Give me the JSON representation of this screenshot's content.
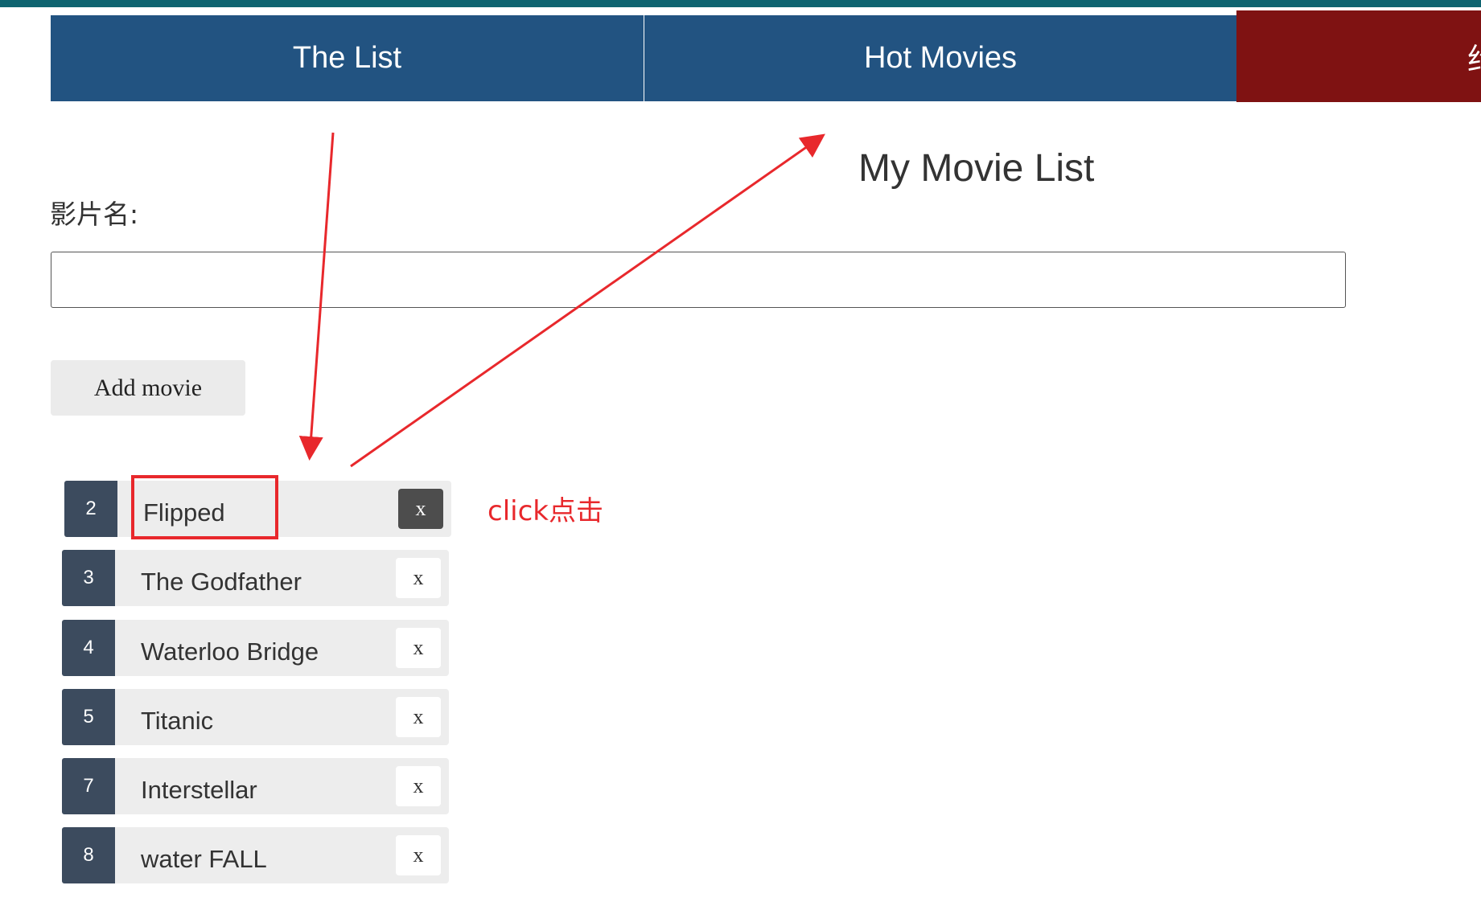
{
  "nav": {
    "tabs": [
      {
        "label": "The List"
      },
      {
        "label": "Hot Movies"
      },
      {
        "label": "约"
      }
    ]
  },
  "page_title": "My Movie List",
  "form": {
    "label": "影片名:",
    "input_value": "",
    "add_button": "Add movie"
  },
  "movies": [
    {
      "num": "2",
      "name": "Flipped",
      "delete": "x"
    },
    {
      "num": "3",
      "name": "The Godfather",
      "delete": "x"
    },
    {
      "num": "4",
      "name": "Waterloo Bridge",
      "delete": "x"
    },
    {
      "num": "5",
      "name": "Titanic",
      "delete": "x"
    },
    {
      "num": "7",
      "name": "Interstellar",
      "delete": "x"
    },
    {
      "num": "8",
      "name": "water FALL",
      "delete": "x"
    }
  ],
  "annotation": {
    "text": "click点击"
  },
  "colors": {
    "nav": "#225381",
    "nav_active": "#7f1212",
    "annotation": "#e8282c",
    "number_badge": "#3c4b5e"
  }
}
